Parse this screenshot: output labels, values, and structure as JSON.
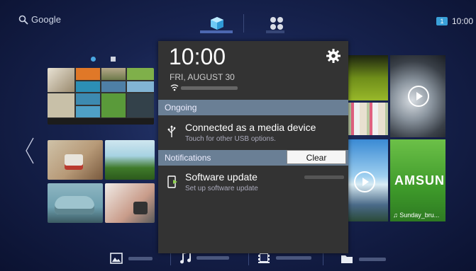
{
  "top_bar": {
    "search_label": "Google",
    "notification_count": "1",
    "time": "10:00"
  },
  "notification_panel": {
    "time": "10:00",
    "date": "FRI, AUGUST 30",
    "sections": {
      "ongoing": "Ongoing",
      "notifications": "Notifications"
    },
    "ongoing_item": {
      "title": "Connected as a media device",
      "subtitle": "Touch for other USB options."
    },
    "clear_label": "Clear",
    "update_item": {
      "title": "Software update",
      "subtitle": "Set up software update"
    },
    "icons": [
      "wifi-icon",
      "settings-gear-icon",
      "usb-icon",
      "software-update-icon"
    ]
  },
  "right_tiles": {
    "samsung_text": "AMSUN",
    "caption": "Sunday_bru..."
  },
  "bottom_bar": {
    "icons": [
      "image-icon",
      "music-icon",
      "video-icon",
      "folder-icon"
    ]
  },
  "colors": {
    "panel_bg": "#333333",
    "section_header": "#6a7f95",
    "badge": "#3aa0d8",
    "accent_indicator": "#5a78c8"
  }
}
